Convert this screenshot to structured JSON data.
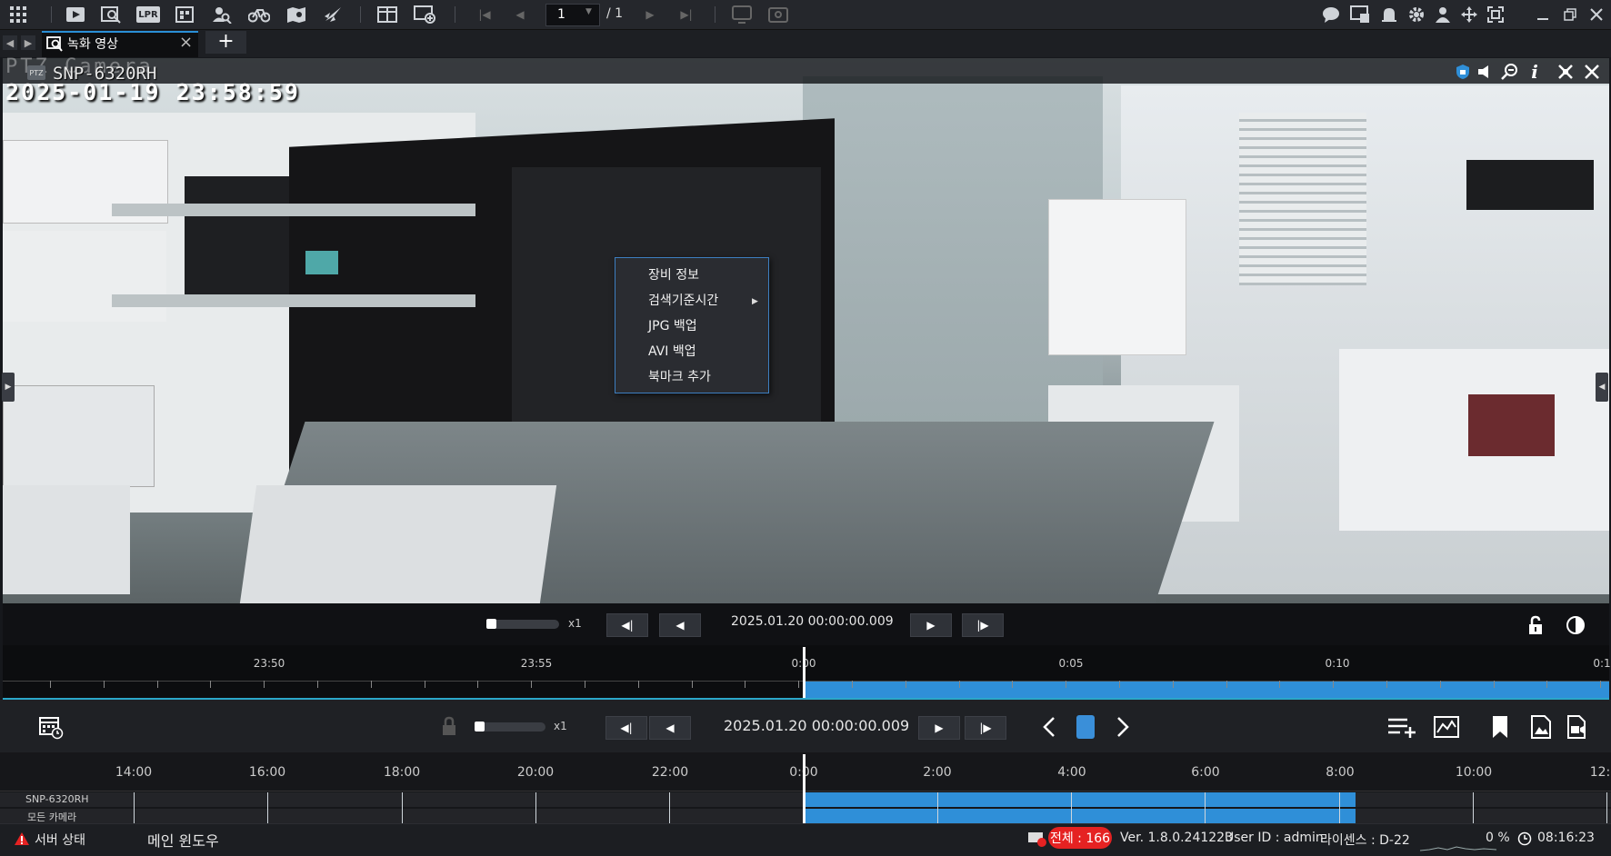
{
  "toolbar": {
    "page_current": "1",
    "page_total": "/ 1",
    "left_icons": [
      "grid-icon",
      "live-view-icon",
      "search-playback-icon",
      "lpr-icon",
      "event-search-icon",
      "face-search-icon",
      "bike-search-icon",
      "map-search-icon",
      "rocket-icon"
    ],
    "lpr_label": "LPR",
    "right_icons": [
      "chat-icon",
      "device-icon",
      "alarm-icon",
      "settings-icon",
      "user-icon",
      "move-icon",
      "fit-icon",
      "minimize-icon",
      "restore-icon",
      "close-icon"
    ]
  },
  "tab": {
    "label": "녹화 영상",
    "add_label": "+"
  },
  "video": {
    "camera_name": "SNP-6320RH",
    "osd_time": "2025-01-19  23:58:59",
    "ghost_text": "PTZ Camera"
  },
  "context_menu": {
    "items": [
      "장비 정보",
      "검색기준시간",
      "JPG 백업",
      "AVI 백업",
      "북마크 추가"
    ]
  },
  "inner_controls": {
    "speed": "x1",
    "datetime": "2025.01.20 00:00:00.009"
  },
  "inner_timeline": {
    "labels": [
      "23:50",
      "23:55",
      "0:00",
      "0:05",
      "0:10",
      "0:1"
    ]
  },
  "lower_controls": {
    "speed": "x1",
    "datetime": "2025.01.20 00:00:00.009"
  },
  "lower_timeline": {
    "labels": [
      "14:00",
      "16:00",
      "18:00",
      "20:00",
      "22:00",
      "0:00",
      "2:00",
      "4:00",
      "6:00",
      "8:00",
      "10:00",
      "12:"
    ],
    "rows": [
      "SNP-6320RH",
      "모든 카메라"
    ]
  },
  "status": {
    "server_status": "서버 상태",
    "main_window": "메인 윈도우",
    "total": "전체 : 166",
    "version": "Ver. 1.8.0.241223",
    "user": "User ID : admin",
    "license": "라이센스 : D-22",
    "cpu": "0 %",
    "clock": "08:16:23"
  },
  "colors": {
    "accent": "#2a8fd6",
    "recorded": "#2f8fd8",
    "alert": "#e52222"
  }
}
